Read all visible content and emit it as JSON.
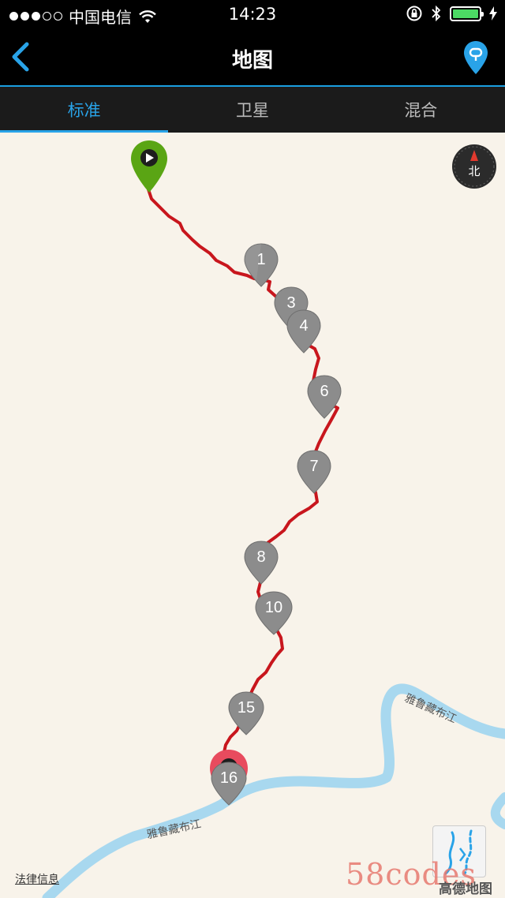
{
  "status_bar": {
    "carrier": "中国电信",
    "time": "14:23",
    "signal_bars_filled": 3,
    "signal_bars_total": 5
  },
  "nav": {
    "title": "地图"
  },
  "tabs": [
    {
      "label": "标准",
      "active": true
    },
    {
      "label": "卫星",
      "active": false
    },
    {
      "label": "混合",
      "active": false
    }
  ],
  "map": {
    "compass_label": "北",
    "waypoints": [
      "1",
      "3",
      "4",
      "6",
      "7",
      "8",
      "10",
      "15",
      "16"
    ],
    "river_labels": [
      "雅鲁藏布江",
      "雅鲁藏布江"
    ],
    "legal_link": "法律信息",
    "watermark": "58codes",
    "provider_logo": "高德地图"
  },
  "colors": {
    "accent": "#29a3e8",
    "track": "#c8161d",
    "start_pin": "#5aa514",
    "end_pin": "#e84b5e",
    "waypoint_pin": "#8c8c8c",
    "river": "#a8d8ef",
    "map_background": "#f8f3ea"
  },
  "icons": {
    "back": "chevron-left-icon",
    "location_pin": "map-pin-icon",
    "compass": "compass-icon",
    "start": "play-icon",
    "map_layers": "map-layers-icon"
  }
}
